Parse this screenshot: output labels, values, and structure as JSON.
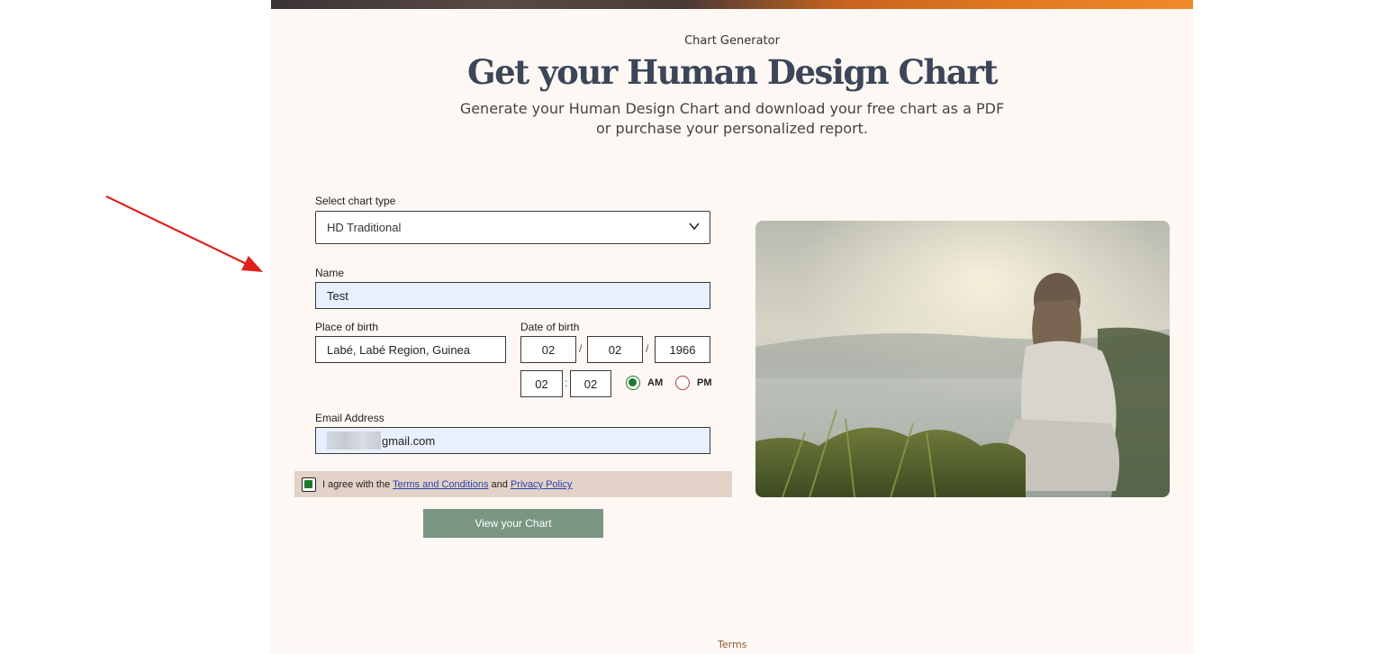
{
  "header": {
    "eyebrow": "Chart Generator",
    "title": "Get your Human Design Chart",
    "subtitle": "Generate your Human Design Chart and download your free chart as a PDF or purchase your personalized report."
  },
  "form": {
    "chart_type_label": "Select chart type",
    "chart_type_value": "HD Traditional",
    "name_label": "Name",
    "name_value": "Test",
    "place_label": "Place of birth",
    "place_value": "Labé, Labé Region, Guinea",
    "dob_label": "Date of birth",
    "dob_month": "02",
    "dob_day": "02",
    "dob_year": "1966",
    "date_sep": "/",
    "time_hour": "02",
    "time_minute": "02",
    "time_sep": ":",
    "am_label": "AM",
    "pm_label": "PM",
    "selected_period": "AM",
    "email_label": "Email Address",
    "email_value_visible": "gmail.com",
    "agree_prefix": "I agree with the",
    "terms_link": "Terms and Conditions",
    "agree_and": "and",
    "privacy_link": "Privacy Policy",
    "agree_checked": true,
    "submit_label": "View your Chart"
  },
  "footer": {
    "terms": "Terms"
  },
  "colors": {
    "panel_bg": "#fdf8f4",
    "title": "#3c4658",
    "button": "#7a9682",
    "agree_bar": "#e2d2c7",
    "filled_input": "#e8effd",
    "radio_selected": "#1e7a2e",
    "annotation_arrow": "#e0201a"
  },
  "icons": [
    "chevron-down-icon",
    "annotation-arrow-icon"
  ]
}
